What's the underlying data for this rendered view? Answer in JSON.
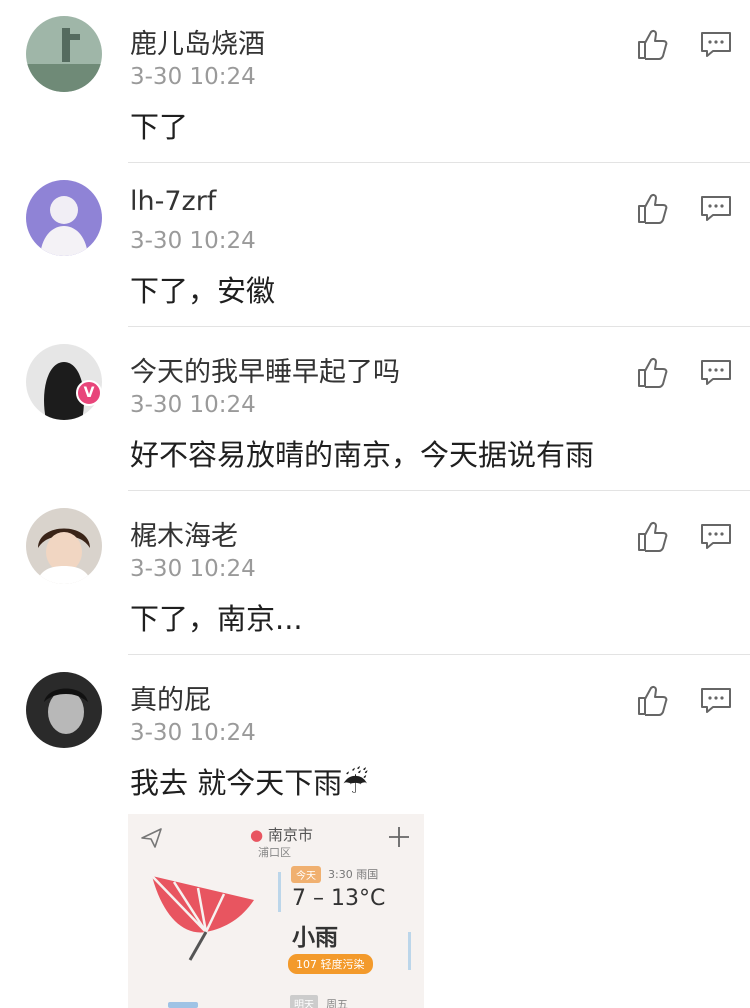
{
  "comments": [
    {
      "username": "鹿儿岛烧酒",
      "timestamp": "3-30 10:24",
      "content": "下了"
    },
    {
      "username": "lh-7zrf",
      "timestamp": "3-30 10:24",
      "content": "下了，安徽"
    },
    {
      "username": "今天的我早睡早起了吗",
      "timestamp": "3-30 10:24",
      "content": "好不容易放晴的南京，今天据说有雨",
      "vip_badge": "V"
    },
    {
      "username": "梶木海老",
      "timestamp": "3-30 10:24",
      "content": "下了，南京..."
    },
    {
      "username": "真的屁",
      "timestamp": "3-30 10:24",
      "content": "我去 就今天下雨☔"
    }
  ],
  "weather_image": {
    "city": "南京市",
    "district": "浦口区",
    "tag": "今天",
    "time": "3:30 雨国",
    "temperature": "7 – 13°C",
    "condition": "小雨",
    "air_quality": "107 轻度污染",
    "bottom_tag": "明天",
    "bottom_text": "周五"
  },
  "icons": {
    "like": "thumbs-up-icon",
    "reply": "comment-bubble-icon",
    "send": "send-icon",
    "add": "plus-icon",
    "umbrella": "umbrella-icon"
  },
  "colors": {
    "umbrella": "#e85560",
    "aqi": "#f39a2b",
    "vip": "#e8457a"
  }
}
